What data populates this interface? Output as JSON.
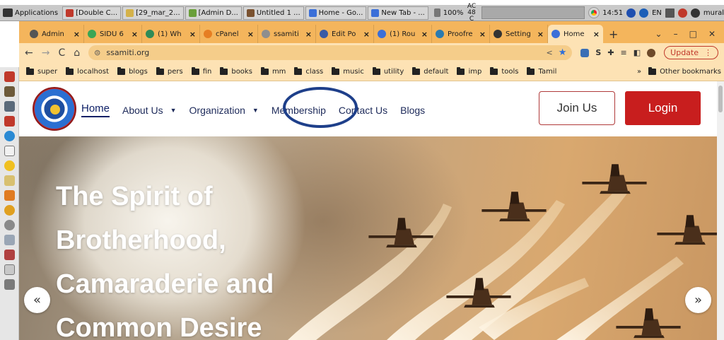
{
  "taskbar": {
    "applications_label": "Applications",
    "tasks": [
      {
        "label": "[Double C...",
        "color": "#c0392b"
      },
      {
        "label": "[29_mar_2...",
        "color": "#d4b24a"
      },
      {
        "label": "[Admin  D...",
        "color": "#6a9f3a"
      },
      {
        "label": "Untitled 1 ...",
        "color": "#7a5230"
      },
      {
        "label": "Home - Go...",
        "color": "#3b6fd8"
      },
      {
        "label": "New Tab - ...",
        "color": "#3b6fd8"
      }
    ],
    "volume": "100%",
    "ac_line1": "AC",
    "ac_line2": "48 C",
    "clock": "14:51",
    "lang": "EN",
    "user": "mural"
  },
  "browser": {
    "tabs": [
      {
        "label": "Admin",
        "color": "#555555",
        "active": false
      },
      {
        "label": "SIDU 6",
        "color": "#3aa655",
        "active": false
      },
      {
        "label": "(1) Wh",
        "color": "#2e8b57",
        "active": false
      },
      {
        "label": "cPanel",
        "color": "#e67e22",
        "active": false
      },
      {
        "label": "ssamiti",
        "color": "#8e8e8e",
        "active": false
      },
      {
        "label": "Edit Po",
        "color": "#3b5ba5",
        "active": false
      },
      {
        "label": "(1) Rou",
        "color": "#3b6fd8",
        "active": false
      },
      {
        "label": "Proofre",
        "color": "#2a7ab0",
        "active": false
      },
      {
        "label": "Setting",
        "color": "#333333",
        "active": false
      },
      {
        "label": "Home",
        "color": "#3b6fd8",
        "active": true
      }
    ],
    "new_tab_symbol": "+",
    "window_controls": {
      "dropdown": "⌄",
      "minimize": "–",
      "maximize": "□",
      "close": "✕"
    },
    "url": "ssamiti.org",
    "update_label": "Update",
    "bookmarks": [
      "super",
      "localhost",
      "blogs",
      "pers",
      "fin",
      "books",
      "mm",
      "class",
      "music",
      "utility",
      "default",
      "imp",
      "tools",
      "Tamil"
    ],
    "more_bookmarks": "»",
    "other_bookmarks": "Other bookmarks"
  },
  "site": {
    "nav": {
      "home": "Home",
      "about": "About Us",
      "organization": "Organization",
      "membership": "Membership",
      "contact": "Contact Us",
      "blogs": "Blogs",
      "join": "Join Us",
      "login": "Login"
    },
    "hero": {
      "line1": "The Spirit of",
      "line2": "Brotherhood,",
      "line3": "Camaraderie and",
      "line4": "Common Desire",
      "prev": "«",
      "next": "»"
    }
  },
  "colors": {
    "tab_strip": "#f4b55c",
    "toolbar": "#fde2b4",
    "brand_red": "#c81e1e",
    "nav_text": "#1d2a5a",
    "highlight_ring": "#1e3f8a"
  }
}
